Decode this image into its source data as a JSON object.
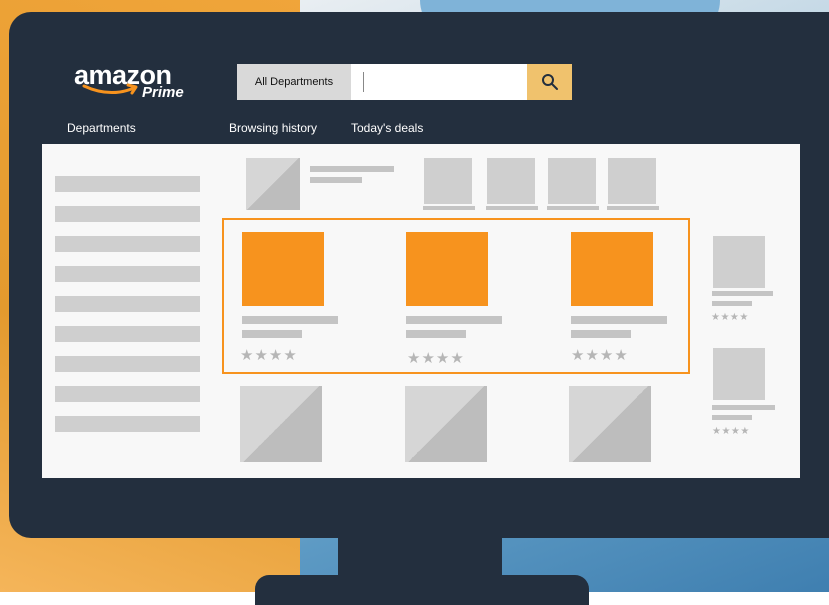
{
  "brand": {
    "name": "amazon",
    "sub": "Prime",
    "color": "#f7931e"
  },
  "search": {
    "department": "All Departments",
    "placeholder": "",
    "icon": "search-icon"
  },
  "nav": {
    "departments": "Departments",
    "history": "Browsing history",
    "deals": "Today's deals"
  },
  "product_rating_stars": "★★★★",
  "colors": {
    "frame": "#232f3e",
    "accent": "#f7931e",
    "search_button": "#f0c26d",
    "placeholder": "#cfcfcf"
  }
}
